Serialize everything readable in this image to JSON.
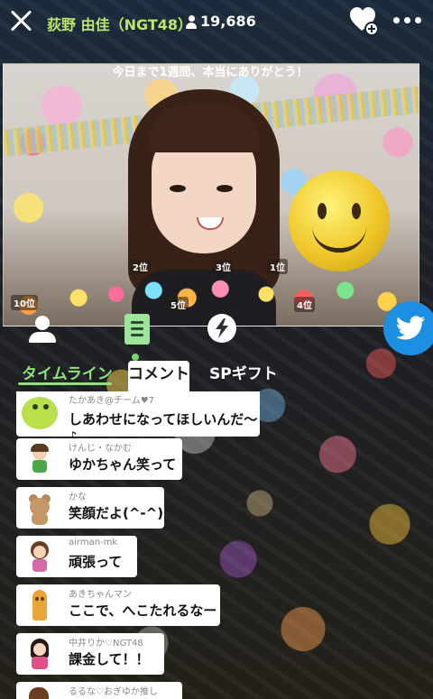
{
  "header": {
    "streamer_name": "荻野 由佳（NGT48）",
    "viewer_count": "19,686"
  },
  "stream": {
    "announcement": "今日まで1週間、本当にありがとう！",
    "rank_tags": [
      "2位",
      "3位",
      "1位",
      "10位",
      "5位",
      "4位"
    ]
  },
  "tabs": [
    {
      "label": "タイムライン",
      "active": true
    },
    {
      "label": "コメント",
      "active": false
    },
    {
      "label": "SPギフト",
      "active": false
    }
  ],
  "comments": [
    {
      "user": "たかあき@チーム♥7",
      "text": "しあわせになってほしいんだ〜♪",
      "icon": "green-blob-avatar"
    },
    {
      "user": "けんじ・なかむ",
      "text": "ゆかちゃん笑って",
      "icon": "boy-avatar"
    },
    {
      "user": "かな",
      "text": "笑顔だよ(^-^)",
      "icon": "bear-avatar"
    },
    {
      "user": "airman-mk",
      "text": "頑張って",
      "icon": "girl-avatar"
    },
    {
      "user": "あきちゃんマン",
      "text": "ここで、へこたれるなー",
      "icon": "statue-avatar"
    },
    {
      "user": "中井りか♡NGT48",
      "text": "課金して！！",
      "icon": "idol-avatar"
    },
    {
      "user": "るるな♡おぎゆか推し",
      "text": "",
      "icon": "avatar"
    }
  ],
  "colors": {
    "accent": "#8fe27a",
    "streamer_name": "#b9e86a",
    "twitter": "#1c8fe3"
  }
}
